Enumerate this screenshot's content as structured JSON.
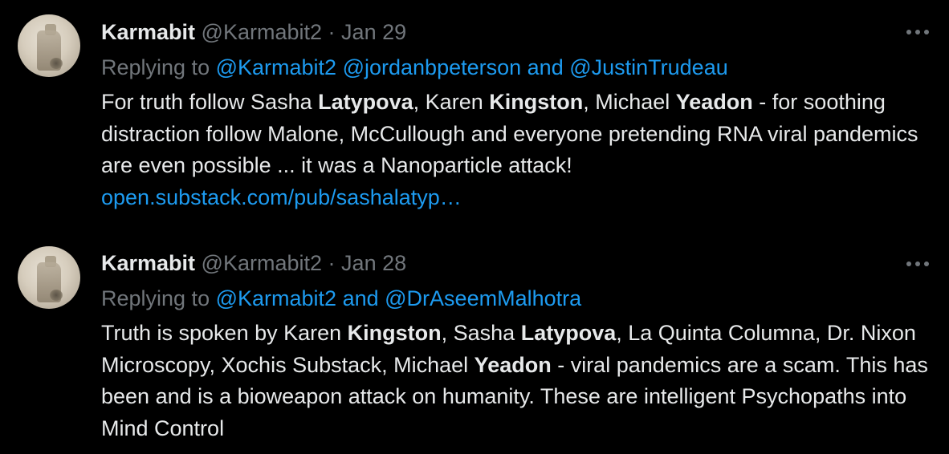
{
  "tweets": [
    {
      "display_name": "Karmabit",
      "handle": "@Karmabit2",
      "separator": "·",
      "date": "Jan 29",
      "replying_to_prefix": "Replying to",
      "mentions": [
        "@Karmabit2",
        "@jordanbpeterson",
        "@JustinTrudeau"
      ],
      "mention_joiners": [
        " ",
        " and "
      ],
      "body_segments": [
        {
          "text": "For truth follow Sasha ",
          "bold": false
        },
        {
          "text": "Latypova",
          "bold": true
        },
        {
          "text": ", Karen ",
          "bold": false
        },
        {
          "text": "Kingston",
          "bold": true
        },
        {
          "text": ", Michael ",
          "bold": false
        },
        {
          "text": "Yeadon",
          "bold": true
        },
        {
          "text": " - for soothing distraction follow Malone, McCullough and everyone pretending RNA viral pandemics are even possible ... it was a Nanoparticle attack!",
          "bold": false
        }
      ],
      "link_text": "open.substack.com/pub/sashalatyp…"
    },
    {
      "display_name": "Karmabit",
      "handle": "@Karmabit2",
      "separator": "·",
      "date": "Jan 28",
      "replying_to_prefix": "Replying to",
      "mentions": [
        "@Karmabit2",
        "@DrAseemMalhotra"
      ],
      "mention_joiners": [
        " and "
      ],
      "body_segments": [
        {
          "text": "Truth is spoken by Karen ",
          "bold": false
        },
        {
          "text": "Kingston",
          "bold": true
        },
        {
          "text": ", Sasha ",
          "bold": false
        },
        {
          "text": "Latypova",
          "bold": true
        },
        {
          "text": ", La Quinta Columna, Dr. Nixon Microscopy, Xochis Substack, Michael ",
          "bold": false
        },
        {
          "text": "Yeadon",
          "bold": true
        },
        {
          "text": " - viral pandemics are a scam. This has been and is a bioweapon attack on humanity. These are intelligent Psychopaths into Mind Control",
          "bold": false
        }
      ],
      "link_text": ""
    }
  ],
  "icons": {
    "more": "more-horizontal-icon",
    "avatar": "avatar"
  },
  "colors": {
    "background": "#000000",
    "text": "#e7e9ea",
    "muted": "#71767b",
    "accent": "#1d9bf0"
  }
}
